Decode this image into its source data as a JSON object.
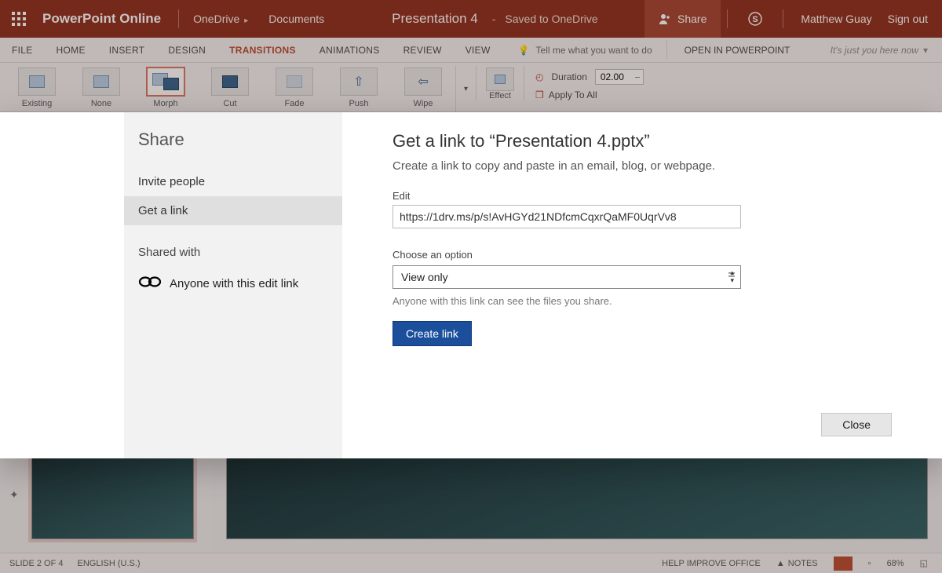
{
  "titlebar": {
    "app_name": "PowerPoint Online",
    "breadcrumb": [
      "OneDrive",
      "Documents"
    ],
    "doc_title": "Presentation 4",
    "saved_status": "Saved to OneDrive",
    "share_label": "Share",
    "user_name": "Matthew Guay",
    "signout_label": "Sign out"
  },
  "ribbon": {
    "tabs": [
      "FILE",
      "HOME",
      "INSERT",
      "DESIGN",
      "TRANSITIONS",
      "ANIMATIONS",
      "REVIEW",
      "VIEW"
    ],
    "active_tab": "TRANSITIONS",
    "tell_me": "Tell me what you want to do",
    "open_in": "OPEN IN POWERPOINT",
    "presence": "It's just you here now"
  },
  "transitions": {
    "items": [
      "Existing",
      "None",
      "Morph",
      "Cut",
      "Fade",
      "Push",
      "Wipe"
    ],
    "selected": "Morph",
    "effect_options_label": "Effect",
    "duration_label": "Duration",
    "duration_value": "02.00",
    "apply_all_label": "Apply To All"
  },
  "statusbar": {
    "slide_counter": "SLIDE 2 OF 4",
    "language": "ENGLISH (U.S.)",
    "help_improve": "HELP IMPROVE OFFICE",
    "notes_label": "NOTES",
    "zoom": "68%"
  },
  "share_dialog": {
    "panel_title": "Share",
    "menu": {
      "invite": "Invite people",
      "get_link": "Get a link"
    },
    "shared_with_label": "Shared with",
    "shared_with_entry": "Anyone with this edit link",
    "heading": "Get a link to “Presentation 4.pptx”",
    "desc": "Create a link to copy and paste in an email, blog, or webpage.",
    "edit_label": "Edit",
    "url": "https://1drv.ms/p/s!AvHGYd21NDfcmCqxrQaMF0UqrVv8",
    "choose_option_label": "Choose an option",
    "option_selected": "View only",
    "option_hint": "Anyone with this link can see the files you share.",
    "create_link_label": "Create link",
    "close_label": "Close"
  }
}
